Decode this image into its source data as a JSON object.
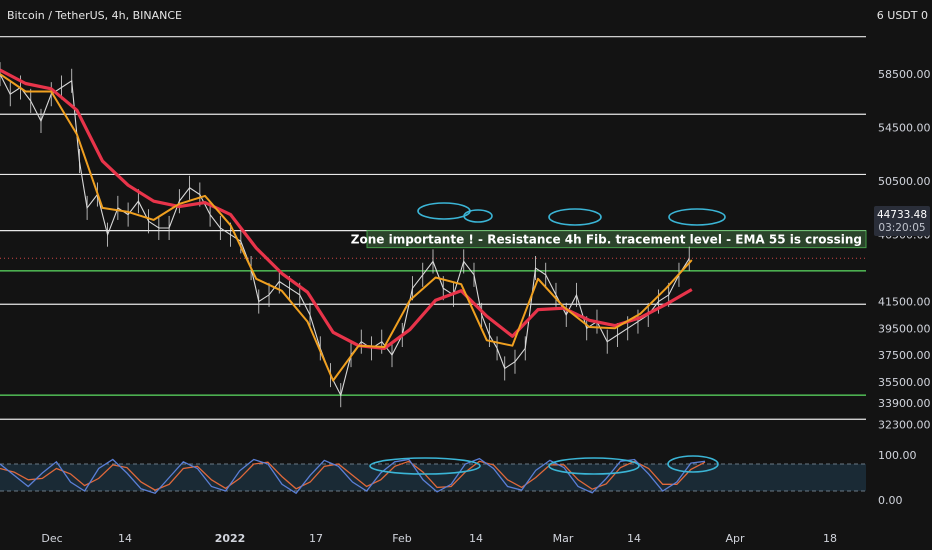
{
  "header": {
    "symbol_title": "Bitcoin / TetherUS, 4h, BINANCE",
    "quote_currency": "6 USDT 0"
  },
  "colors": {
    "background": "#131313",
    "price": "#d9d9d9",
    "ema_fast": "#f0a020",
    "ema_slow": "#e8344a",
    "support_line": "#4caf50",
    "level_line": "#e8e8e8",
    "annotation_circle": "#3bb5d6",
    "stoch_k": "#5b7fd6",
    "stoch_d": "#e0683a",
    "stoch_band": "#1a2a35"
  },
  "chart_data": {
    "type": "line",
    "title": "Bitcoin / TetherUS, 4h, BINANCE",
    "ylim": [
      31000,
      61500
    ],
    "grid": false,
    "x_ticks": [
      "Dec",
      "14",
      "2022",
      "17",
      "Feb",
      "14",
      "Mar",
      "14",
      "Apr",
      "18"
    ],
    "y_ticks": [
      "58500.00",
      "54500.00",
      "50500.00",
      "46500.00",
      "41500.00",
      "39500.00",
      "37500.00",
      "35500.00",
      "33900.00",
      "32300.00"
    ],
    "last_price": "44733.48",
    "countdown": "03:20:05",
    "levels": [
      {
        "price": 61300,
        "kind": "resistance"
      },
      {
        "price": 55500,
        "kind": "resistance"
      },
      {
        "price": 51000,
        "kind": "resistance"
      },
      {
        "price": 46800,
        "kind": "resistance"
      },
      {
        "price": 43800,
        "kind": "key_zone"
      },
      {
        "price": 41300,
        "kind": "support"
      },
      {
        "price": 34500,
        "kind": "key_zone"
      },
      {
        "price": 32700,
        "kind": "support"
      }
    ],
    "annotation": "Zone importante ! - Resistance 4h Fib. tracement level  - EMA 55 is crossing",
    "price_x": [
      0,
      4,
      8,
      12,
      16,
      20,
      24,
      28,
      31,
      34,
      38,
      42,
      46,
      50,
      54,
      58,
      62,
      66,
      70,
      74,
      78,
      82,
      86,
      90,
      94,
      98,
      101,
      105,
      109,
      113,
      117,
      121,
      125,
      129,
      133
    ],
    "price_y": [
      58500,
      57000,
      57500,
      56500,
      55000,
      57000,
      57500,
      58000,
      52000,
      48500,
      49500,
      46500,
      48500,
      48000,
      49000,
      47500,
      47000,
      47000,
      49000,
      50000,
      49500,
      48000,
      47000,
      46500,
      46000,
      44000,
      41500,
      42000,
      43000,
      42500,
      42000,
      40500,
      38000,
      36000,
      34500
    ],
    "price_x2": [
      137,
      141,
      145,
      149,
      153,
      157,
      161,
      165,
      169,
      173,
      177,
      181,
      185,
      188,
      191,
      194,
      197,
      201,
      205,
      209,
      213,
      217,
      221,
      225,
      229,
      233,
      237,
      241,
      245,
      249,
      253,
      257,
      261,
      265,
      269
    ],
    "price_y2": [
      37500,
      38500,
      38000,
      38500,
      37500,
      39000,
      42500,
      43500,
      44500,
      42500,
      42000,
      44500,
      43500,
      40500,
      39000,
      38000,
      36500,
      37000,
      38000,
      44000,
      43500,
      42000,
      40500,
      42000,
      39500,
      40000,
      38500,
      39000,
      39500,
      40000,
      40500,
      41500,
      42000,
      43500,
      44700
    ],
    "ema_fast_x": [
      0,
      10,
      20,
      30,
      40,
      50,
      60,
      70,
      80,
      90,
      100,
      110,
      120,
      130,
      140,
      150,
      160,
      170,
      180,
      190,
      200,
      210,
      220,
      230,
      240,
      250,
      260,
      270
    ],
    "ema_fast_y": [
      58500,
      57200,
      57200,
      54000,
      48500,
      48200,
      47600,
      48800,
      49400,
      47200,
      43200,
      42300,
      40000,
      35600,
      38200,
      38100,
      41600,
      43300,
      42800,
      38600,
      38200,
      43200,
      41100,
      39600,
      39500,
      40600,
      42500,
      44600
    ],
    "ema_slow_x": [
      0,
      10,
      20,
      30,
      40,
      50,
      60,
      70,
      80,
      90,
      100,
      110,
      120,
      130,
      140,
      150,
      160,
      170,
      180,
      190,
      200,
      210,
      220,
      230,
      240,
      250,
      260,
      270
    ],
    "ema_slow_y": [
      58800,
      57800,
      57400,
      55800,
      52000,
      50200,
      49000,
      48600,
      48900,
      48000,
      45500,
      43600,
      42200,
      39200,
      38200,
      38000,
      39400,
      41600,
      42300,
      40400,
      38900,
      40900,
      41000,
      40100,
      39700,
      40300,
      41300,
      42400
    ],
    "stoch_ylim": [
      0,
      100
    ],
    "stoch_levels": [
      80,
      20
    ],
    "stoch_ticks": [
      "100.00",
      "0.00"
    ],
    "stoch_k": [
      80,
      55,
      30,
      60,
      85,
      40,
      20,
      70,
      90,
      60,
      25,
      15,
      50,
      85,
      70,
      30,
      20,
      65,
      90,
      80,
      35,
      15,
      55,
      88,
      75,
      40,
      20,
      60,
      85,
      90,
      45,
      18,
      35,
      80,
      92,
      70,
      30,
      22,
      66,
      88,
      72,
      30,
      16,
      48,
      86,
      90,
      58,
      20,
      40,
      82,
      86
    ],
    "stoch_d": [
      70,
      62,
      45,
      48,
      70,
      58,
      32,
      48,
      78,
      72,
      40,
      22,
      35,
      70,
      75,
      45,
      26,
      48,
      80,
      84,
      52,
      25,
      40,
      75,
      80,
      55,
      30,
      45,
      75,
      86,
      62,
      28,
      30,
      62,
      86,
      78,
      45,
      28,
      50,
      78,
      78,
      45,
      24,
      36,
      72,
      86,
      70,
      35,
      35,
      68,
      84
    ]
  }
}
